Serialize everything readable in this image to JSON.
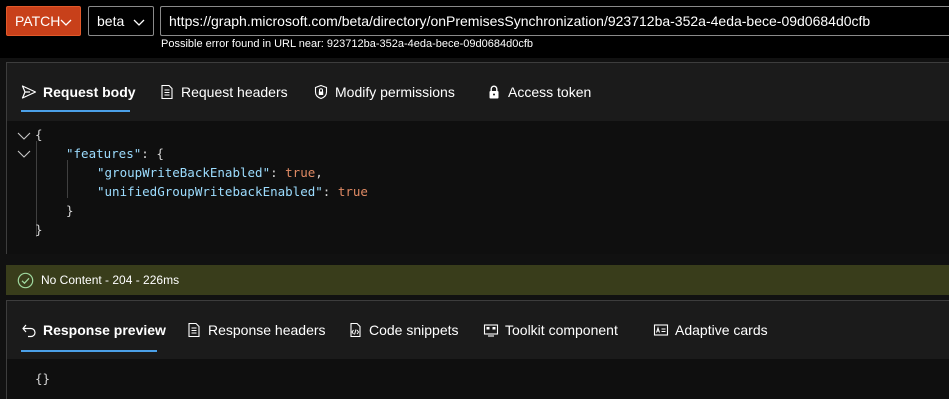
{
  "request": {
    "method": "PATCH",
    "version": "beta",
    "url": "https://graph.microsoft.com/beta/directory/onPremisesSynchronization/923712ba-352a-4eda-bece-09d0684d0cfb",
    "url_error": "Possible error found in URL near: 923712ba-352a-4eda-bece-09d0684d0cfb"
  },
  "request_tabs": [
    {
      "label": "Request body",
      "icon": "send-icon",
      "active": true
    },
    {
      "label": "Request headers",
      "icon": "document-icon",
      "active": false
    },
    {
      "label": "Modify permissions",
      "icon": "shield-lock-icon",
      "active": false
    },
    {
      "label": "Access token",
      "icon": "lock-icon",
      "active": false
    }
  ],
  "request_body": {
    "open_brace": "{",
    "features_key": "\"features\"",
    "features_open": ": {",
    "key1": "\"groupWriteBackEnabled\"",
    "sep1": ": ",
    "val1": "true",
    "comma1": ",",
    "key2": "\"unifiedGroupWritebackEnabled\"",
    "sep2": ": ",
    "val2": "true",
    "inner_close": "}",
    "outer_close": "}"
  },
  "status": {
    "text": "No Content - 204 - 226ms",
    "color": "#393d1b"
  },
  "response_tabs": [
    {
      "label": "Response preview",
      "icon": "undo-arrow-icon",
      "active": true
    },
    {
      "label": "Response headers",
      "icon": "document-icon",
      "active": false
    },
    {
      "label": "Code snippets",
      "icon": "code-snippet-icon",
      "active": false
    },
    {
      "label": "Toolkit component",
      "icon": "toolkit-icon",
      "active": false
    },
    {
      "label": "Adaptive cards",
      "icon": "card-icon",
      "active": false
    }
  ],
  "response_body": "{}",
  "colors": {
    "method_bg": "#c8401a",
    "accent": "#4ba0e8",
    "json_key": "#9cdcfe",
    "json_bool": "#e08a64"
  }
}
